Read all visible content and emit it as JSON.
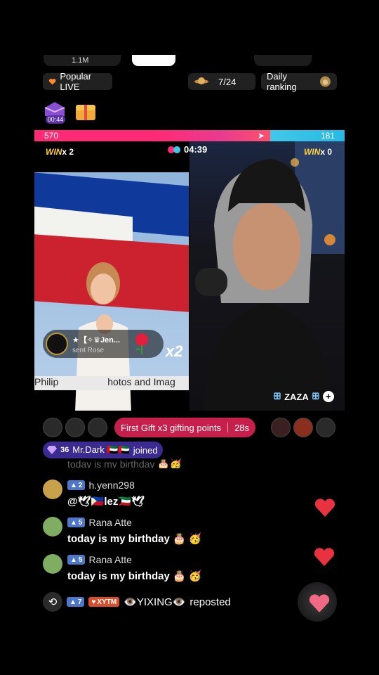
{
  "top_row": {
    "viewer_count": "1.1M"
  },
  "labels": {
    "popular_live": "Popular LIVE",
    "page_indicator": "7/24",
    "daily_ranking": "Daily ranking",
    "treasure_timer": "00:44"
  },
  "battle": {
    "left_score": "570",
    "right_score": "181",
    "timer": "04:39",
    "left_win": "x 2",
    "right_win": "x 0",
    "win_word": "WIN",
    "left_fill_fraction": 0.76
  },
  "left_stream": {
    "caption_left": "Philip",
    "caption_right": "hotos and Imag",
    "gift": {
      "sender": "★【✧♛Jen...",
      "action": "sent Rose",
      "multiplier": "x2"
    }
  },
  "right_stream": {
    "name": "ZAZA",
    "follow_icon": "plus-icon"
  },
  "first_gift": {
    "text": "First Gift x3 gifting points",
    "countdown": "28s"
  },
  "join_notice": {
    "level": "36",
    "user": "Mr.Dark 🇦🇪🇦🇪",
    "action": "joined"
  },
  "faded_comment": "today is my birthday 🎂🥳",
  "comments": [
    {
      "level": "2",
      "user": "h.yenn298",
      "text": "@🕊🇵🇭lez🇰🇼🕊",
      "avatar_color": "#c7a24a"
    },
    {
      "level": "5",
      "user": "Rana Atte",
      "text": "today is my birthday 🎂 🥳",
      "avatar_color": "#7fae63"
    },
    {
      "level": "5",
      "user": "Rana Atte",
      "text": "today is my birthday 🎂 🥳",
      "avatar_color": "#7fae63"
    }
  ],
  "repost": {
    "level": "7",
    "fan_badge": "XYTM",
    "user": "👁️YIXING👁️",
    "action": "reposted"
  },
  "colors": {
    "accent_pink": "#ff2a76",
    "accent_blue": "#40c8e8",
    "first_gift_bg": "#c71f4b",
    "heart": "#e8323f"
  }
}
